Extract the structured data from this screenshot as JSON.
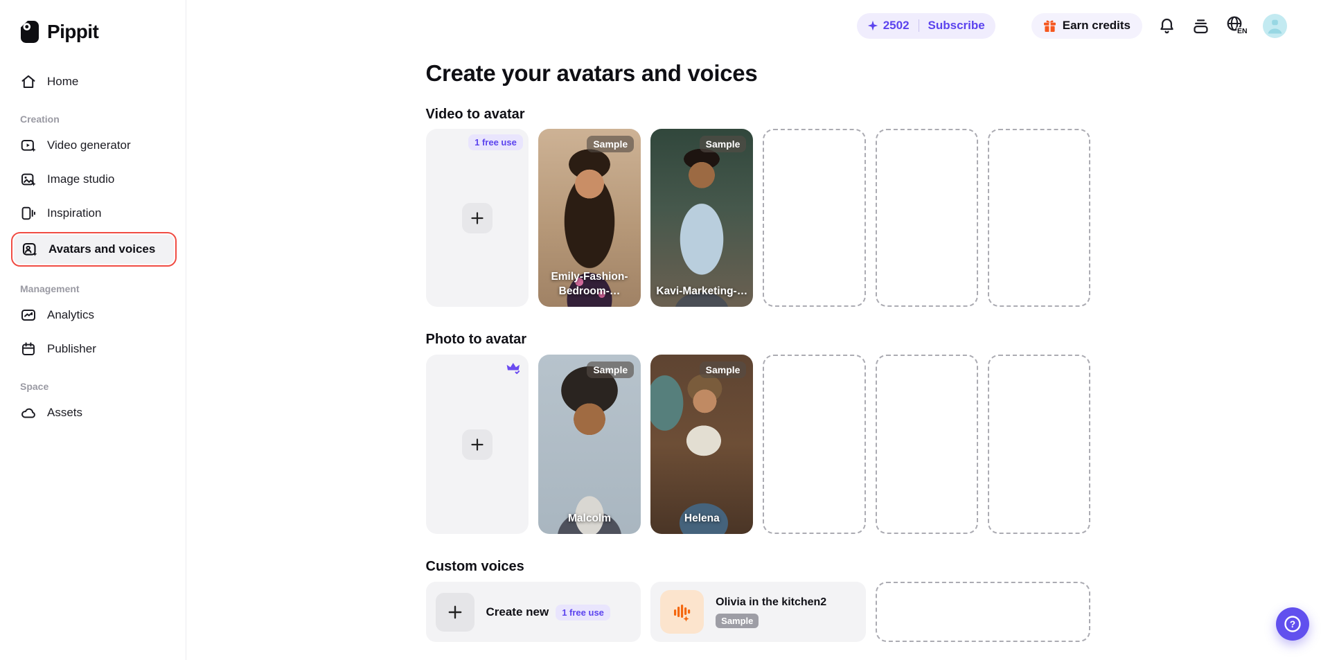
{
  "app": {
    "name": "Pippit"
  },
  "header": {
    "credits": "2502",
    "subscribe_label": "Subscribe",
    "earn_credits_label": "Earn credits",
    "language": "EN"
  },
  "sidebar": {
    "home": "Home",
    "creation_label": "Creation",
    "video_generator": "Video generator",
    "image_studio": "Image studio",
    "inspiration": "Inspiration",
    "avatars_and_voices": "Avatars and voices",
    "management_label": "Management",
    "analytics": "Analytics",
    "publisher": "Publisher",
    "space_label": "Space",
    "assets": "Assets"
  },
  "main": {
    "page_title": "Create your avatars and voices",
    "video_to_avatar": {
      "title": "Video to avatar",
      "free_use_badge": "1 free use",
      "sample_badge": "Sample",
      "avatars": [
        {
          "name": "Emily-Fashion-Bedroom-…"
        },
        {
          "name": "Kavi-Marketing-…"
        }
      ],
      "empty_slots": 3
    },
    "photo_to_avatar": {
      "title": "Photo to avatar",
      "sample_badge": "Sample",
      "avatars": [
        {
          "name": "Malcolm"
        },
        {
          "name": "Helena"
        }
      ],
      "empty_slots": 3
    },
    "custom_voices": {
      "title": "Custom voices",
      "create_new_label": "Create new",
      "free_use_badge": "1 free use",
      "voices": [
        {
          "name": "Olivia in the kitchen2",
          "badge": "Sample"
        }
      ],
      "empty_slots": 1
    }
  },
  "icons": {
    "credits": "sparkle-icon",
    "earn": "gift-icon",
    "notifications": "bell-icon",
    "billing": "card-stack-icon",
    "language": "globe-icon",
    "premium": "crown-icon",
    "voice": "waveform-icon",
    "help_glyph": "?"
  },
  "colors": {
    "accent_purple": "#5b43ee",
    "badge_lavender_bg": "#e9e5fd",
    "earn_orange": "#f5571f",
    "active_outline_red": "#f04b42",
    "help_button_purple": "#6150ee"
  }
}
